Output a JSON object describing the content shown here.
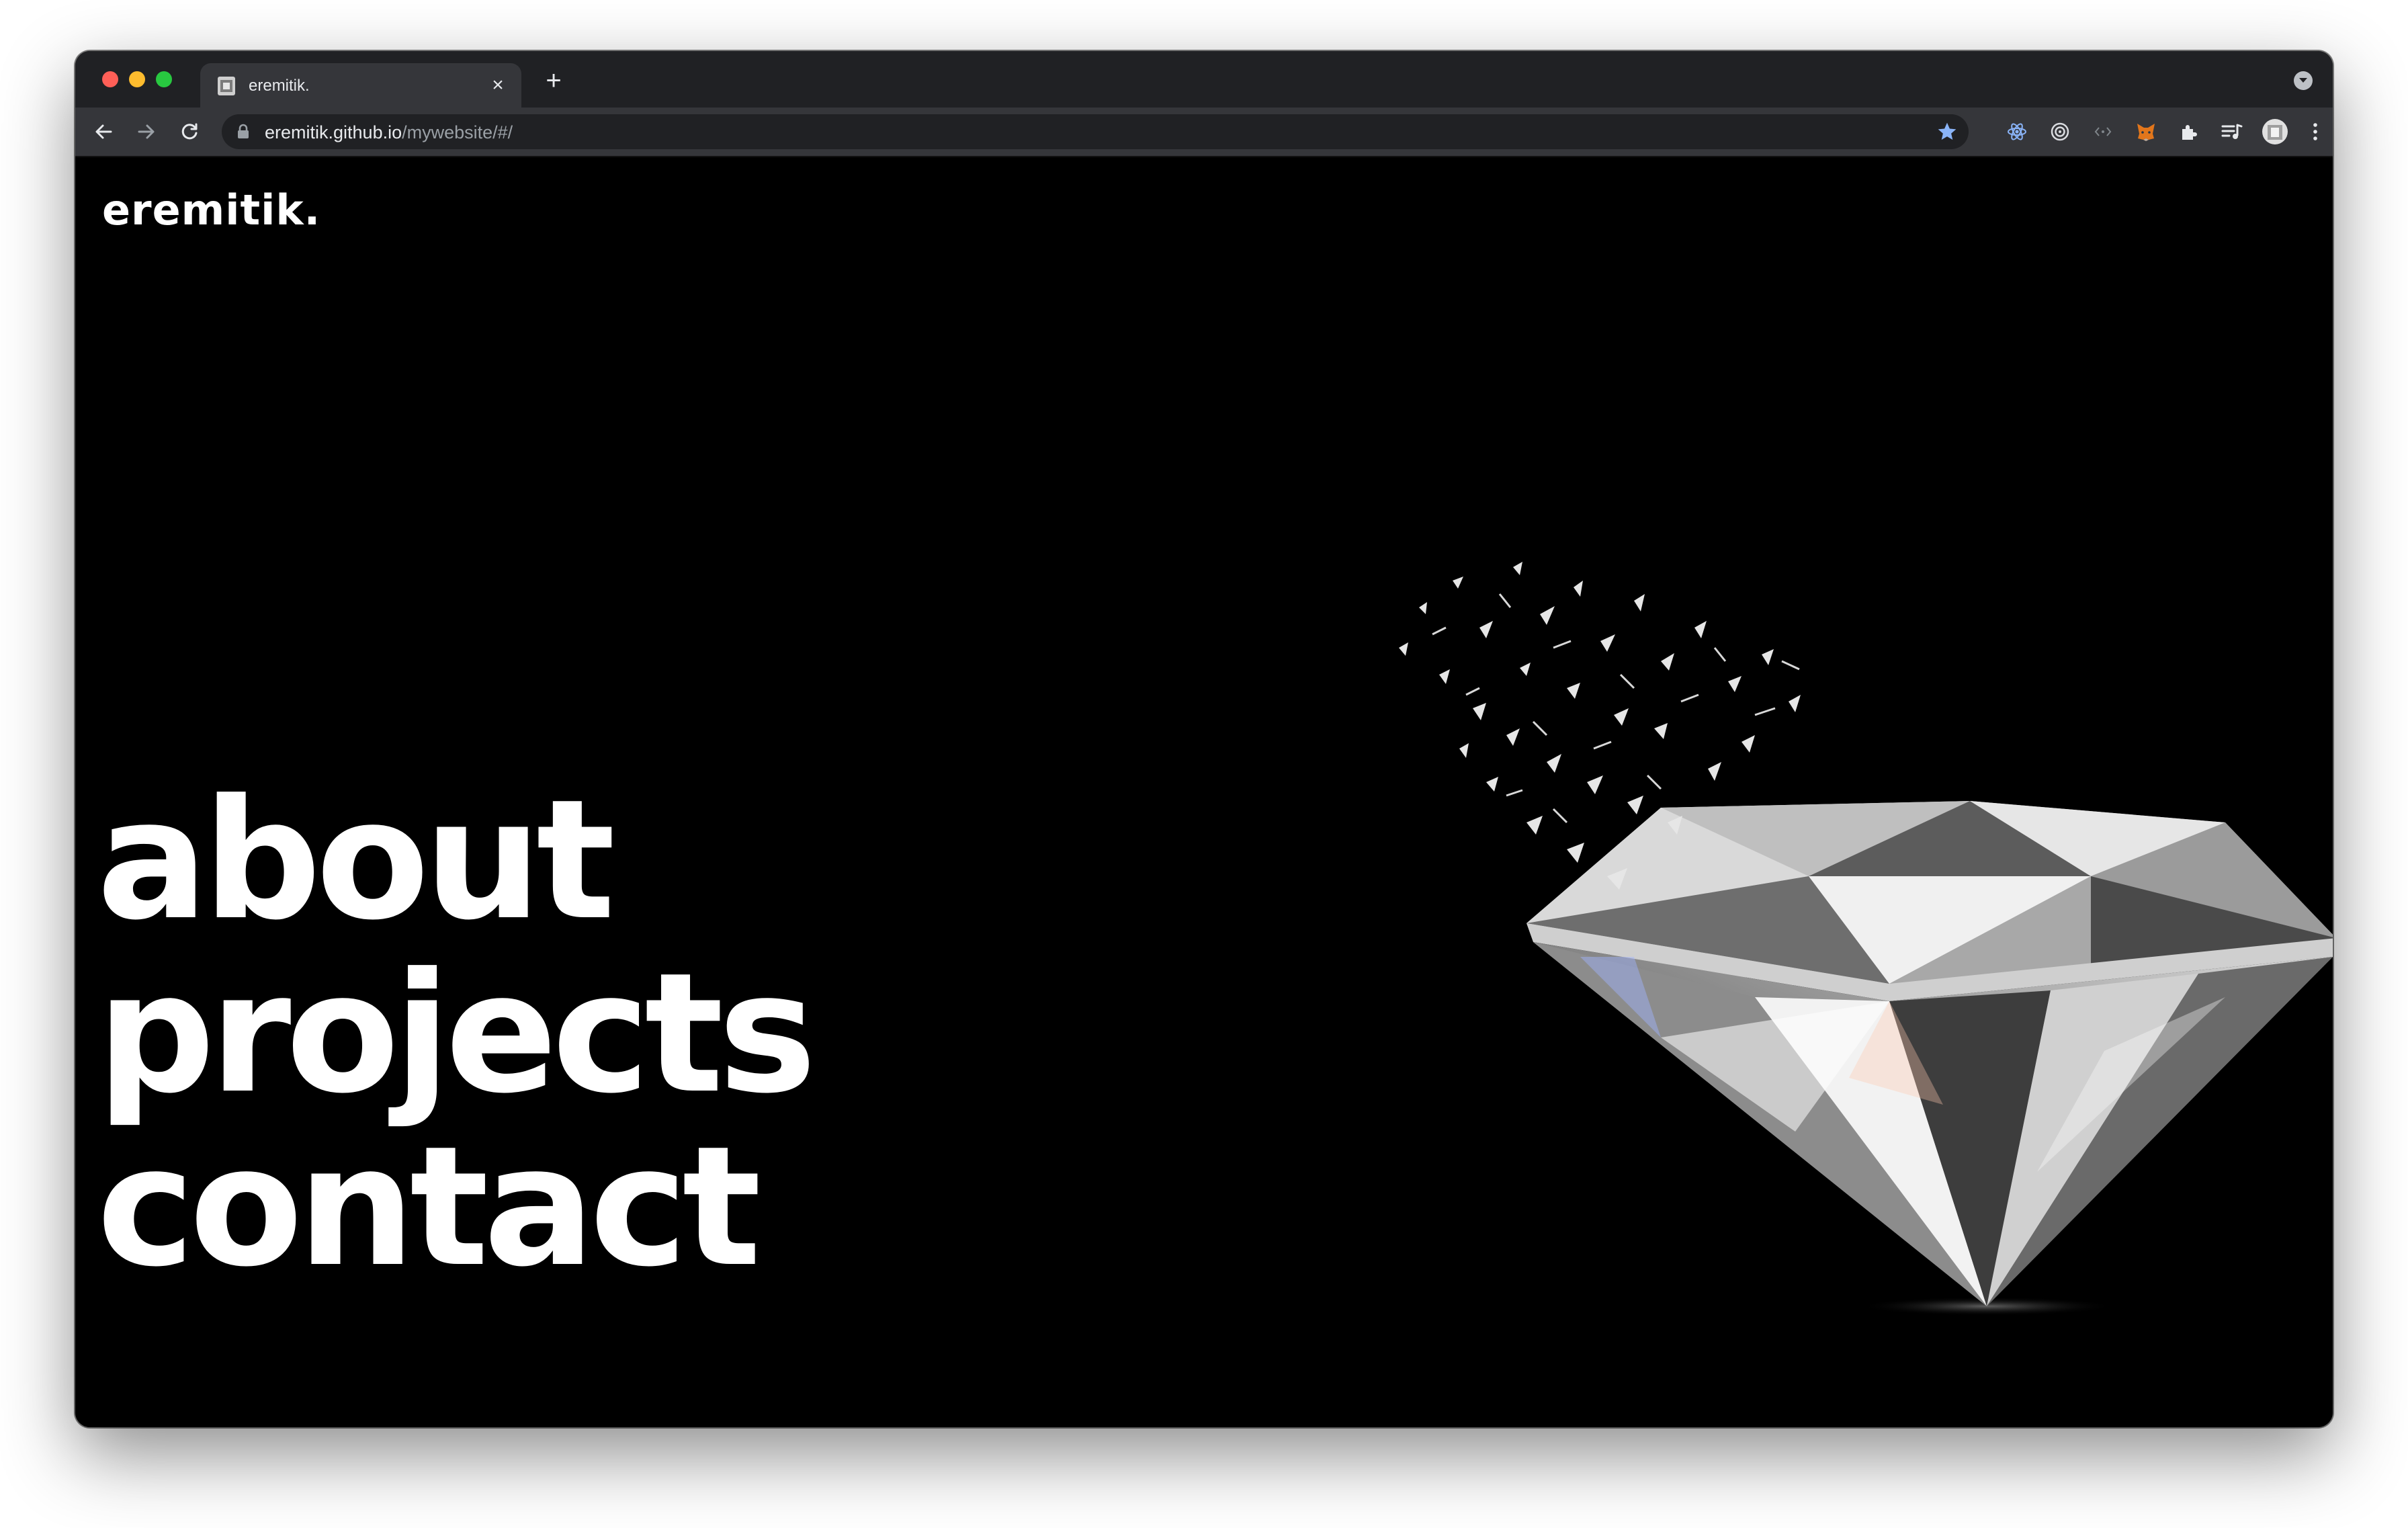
{
  "browser": {
    "tab": {
      "title": "eremitik.",
      "close_glyph": "×"
    },
    "new_tab_glyph": "+",
    "address": {
      "host": "eremitik.github.io",
      "path": "/mywebsite/#/"
    },
    "toolbar_icons": [
      "back-icon",
      "forward-icon",
      "reload-icon",
      "lock-icon",
      "bookmark-star-icon",
      "react-devtools-icon",
      "target-icon",
      "code-icon",
      "metamask-fox-icon",
      "puzzle-extensions-icon",
      "media-queue-icon",
      "profile-avatar",
      "more-menu-icon"
    ],
    "accent_color": "#8ab4f8"
  },
  "site": {
    "logo": "eremitik.",
    "nav": [
      "about",
      "projects",
      "contact"
    ],
    "background_color": "#000000",
    "text_color": "#ffffff",
    "hero_image": "shattering-diamond"
  }
}
